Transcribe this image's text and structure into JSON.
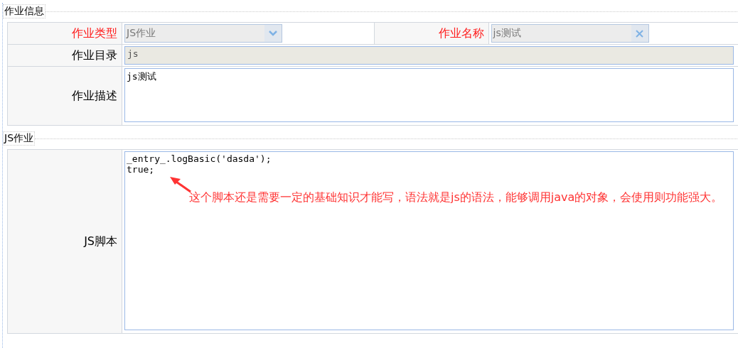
{
  "sections": [
    {
      "legend": "作业信息",
      "rows": [
        {
          "cells": [
            {
              "label": "作业类型",
              "required": true,
              "kind": "select",
              "value": "JS作业"
            },
            {
              "label": "作业名称",
              "required": true,
              "kind": "clearable",
              "value": "js测试"
            }
          ]
        },
        {
          "cells": [
            {
              "label": "作业目录",
              "required": false,
              "kind": "readonly",
              "value": "js"
            }
          ]
        },
        {
          "cells": [
            {
              "label": "作业描述",
              "required": false,
              "kind": "textarea",
              "value": "js测试"
            }
          ]
        }
      ]
    },
    {
      "legend": "JS作业",
      "rows": [
        {
          "cells": [
            {
              "label": "JS脚本",
              "required": false,
              "kind": "code",
              "value": "_entry_.logBasic('dasda');\ntrue;"
            }
          ]
        }
      ]
    }
  ],
  "annotation": {
    "text": "这个脚本还是需要一定的基础知识才能写，语法就是js的语法，能够调用java的对象，会使用则功能强大。"
  }
}
